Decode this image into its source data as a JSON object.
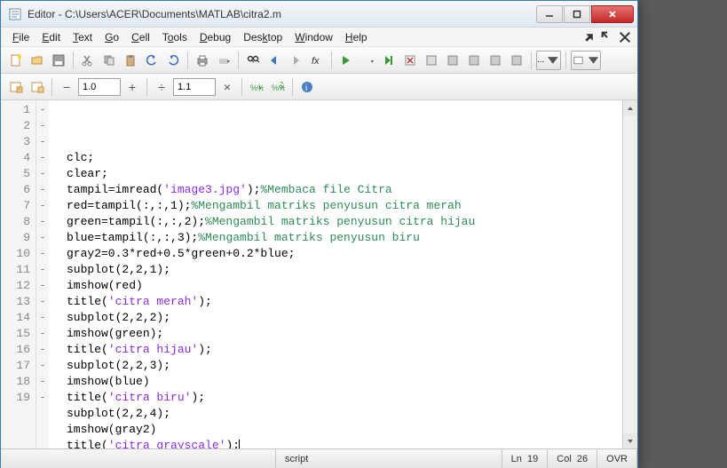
{
  "window": {
    "title": "Editor - C:\\Users\\ACER\\Documents\\MATLAB\\citra2.m"
  },
  "menu": {
    "file": "File",
    "edit": "Edit",
    "text": "Text",
    "go": "Go",
    "cell": "Cell",
    "tools": "Tools",
    "debug": "Debug",
    "desktop": "Desktop",
    "window": "Window",
    "help": "Help"
  },
  "toolbar2": {
    "zoom": "1.0",
    "step": "1.1"
  },
  "code": {
    "lines": [
      {
        "n": 1,
        "bp": "-",
        "t": "clc;"
      },
      {
        "n": 2,
        "bp": "-",
        "t": "clear;"
      },
      {
        "n": 3,
        "bp": "-",
        "t": "tampil=imread(",
        "s": "'image3.jpg'",
        "t2": ");",
        "c": "%Membaca file Citra"
      },
      {
        "n": 4,
        "bp": "-",
        "t": "red=tampil(:,:,1);",
        "c": "%Mengambil matriks penyusun citra merah"
      },
      {
        "n": 5,
        "bp": "-",
        "t": "green=tampil(:,:,2);",
        "c": "%Mengambil matriks penyusun citra hijau"
      },
      {
        "n": 6,
        "bp": "-",
        "t": "blue=tampil(:,:,3);",
        "c": "%Mengambil matriks penyusun biru"
      },
      {
        "n": 7,
        "bp": "-",
        "t": "gray2=0.3*red+0.5*green+0.2*blue;"
      },
      {
        "n": 8,
        "bp": "-",
        "t": "subplot(2,2,1);"
      },
      {
        "n": 9,
        "bp": "-",
        "t": "imshow(red)"
      },
      {
        "n": 10,
        "bp": "-",
        "t": "title(",
        "s": "'citra merah'",
        "t2": ");"
      },
      {
        "n": 11,
        "bp": "-",
        "t": "subplot(2,2,2);"
      },
      {
        "n": 12,
        "bp": "-",
        "t": "imshow(green);"
      },
      {
        "n": 13,
        "bp": "-",
        "t": "title(",
        "s": "'citra hijau'",
        "t2": ");"
      },
      {
        "n": 14,
        "bp": "-",
        "t": "subplot(2,2,3);"
      },
      {
        "n": 15,
        "bp": "-",
        "t": "imshow(blue)"
      },
      {
        "n": 16,
        "bp": "-",
        "t": "title(",
        "s": "'citra biru'",
        "t2": ");"
      },
      {
        "n": 17,
        "bp": "-",
        "t": "subplot(2,2,4);"
      },
      {
        "n": 18,
        "bp": "-",
        "t": "imshow(gray2)"
      },
      {
        "n": 19,
        "bp": "-",
        "t": "title(",
        "s": "'citra grayscale'",
        "t2": ");",
        "cursor": true
      }
    ]
  },
  "status": {
    "type": "script",
    "line_label": "Ln",
    "line": "19",
    "col_label": "Col",
    "col": "26",
    "ovr": "OVR"
  },
  "icons": {
    "minus": "−",
    "plus": "+",
    "div": "÷",
    "times": "×"
  }
}
